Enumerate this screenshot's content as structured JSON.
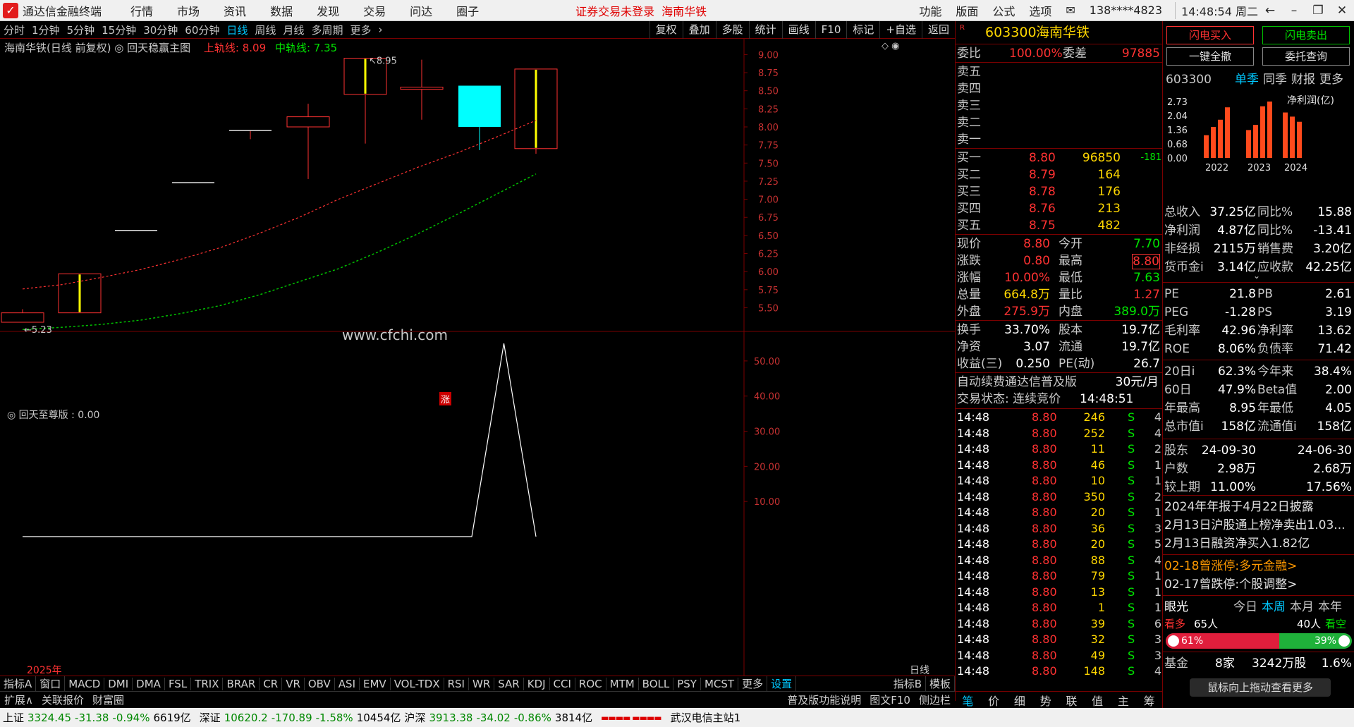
{
  "titlebar": {
    "app": "通达信金融终端",
    "menus": [
      "行情",
      "市场",
      "资讯",
      "数据",
      "发现",
      "交易",
      "问达",
      "圈子"
    ],
    "notice": "证券交易未登录",
    "stock": "海南华铁",
    "right_menus": [
      "功能",
      "版面",
      "公式",
      "选项"
    ],
    "account": "138****4823",
    "clock": "14:48:54 周二"
  },
  "periods": [
    "分时",
    "1分钟",
    "5分钟",
    "15分钟",
    "30分钟",
    "60分钟",
    "日线",
    "周线",
    "月线",
    "多周期",
    "更多"
  ],
  "active_period": "日线",
  "tools": [
    "复权",
    "叠加",
    "多股",
    "统计",
    "画线",
    "F10",
    "标记",
    "+自选",
    "返回"
  ],
  "chart_header": {
    "name": "海南华铁(日线 前复权)",
    "formula": "回天稳赢主图",
    "upper_label": "上轨线: 8.09",
    "mid_label": "中轨线: 7.35"
  },
  "chart_data": [
    {
      "type": "candlestick",
      "ylim": [
        5.3,
        9.15
      ],
      "y_ticks": [
        9.0,
        8.75,
        8.5,
        8.25,
        8.0,
        7.75,
        7.5,
        7.25,
        7.0,
        6.75,
        6.5,
        6.25,
        6.0,
        5.75,
        5.5
      ],
      "candles": [
        {
          "o": 5.3,
          "c": 5.43,
          "h": 5.48,
          "l": 5.3,
          "limit_up": false
        },
        {
          "o": 5.43,
          "c": 5.97,
          "h": 5.97,
          "l": 5.43,
          "limit_up": true
        },
        {
          "o": 6.57,
          "c": 6.57,
          "h": 6.57,
          "l": 6.57,
          "limit_up": false
        },
        {
          "o": 7.23,
          "c": 7.23,
          "h": 7.23,
          "l": 7.23,
          "limit_up": false
        },
        {
          "o": 7.95,
          "c": 7.95,
          "h": 7.95,
          "l": 7.83,
          "limit_up": false
        },
        {
          "o": 8.0,
          "c": 8.14,
          "h": 8.32,
          "l": 7.28,
          "limit_up": false
        },
        {
          "o": 8.45,
          "c": 8.95,
          "h": 8.95,
          "l": 7.77,
          "limit_up": true
        },
        {
          "o": 8.52,
          "c": 8.55,
          "h": 8.93,
          "l": 8.1,
          "limit_up": false
        },
        {
          "o": 8.57,
          "c": 8.0,
          "h": 8.57,
          "l": 7.68,
          "limit_up": false
        },
        {
          "o": 7.7,
          "c": 8.8,
          "h": 8.8,
          "l": 7.63,
          "limit_up": true
        }
      ],
      "upper": [
        5.76,
        5.82,
        5.92,
        6.03,
        6.17,
        6.33,
        6.53,
        6.75,
        7.0,
        7.22,
        7.44,
        7.64,
        7.86,
        8.09
      ],
      "middle": [
        5.2,
        5.23,
        5.27,
        5.33,
        5.42,
        5.53,
        5.68,
        5.86,
        6.04,
        6.27,
        6.52,
        6.79,
        7.07,
        7.35
      ],
      "annotations": {
        "high": "8.95",
        "low": "5.23"
      }
    },
    {
      "type": "line",
      "name": "回天至尊版",
      "value_label": "回天至尊版 : 0.00",
      "ylim": [
        0,
        57
      ],
      "y_ticks": [
        50,
        40,
        30,
        20,
        10
      ],
      "values": [
        0,
        0,
        0,
        0,
        0,
        0,
        0,
        0,
        0,
        0,
        0,
        0,
        0,
        0,
        0,
        55,
        0
      ]
    }
  ],
  "watermark": "www.cfchi.com",
  "limit_mark": "涨",
  "x_label": "2025年",
  "x_period_label": "日线",
  "quote": {
    "code": "603300",
    "name": "海南华铁",
    "badge": "R",
    "wb_label": "委比",
    "wb": "100.00%",
    "wc_label": "委差",
    "wc": "97885",
    "asks": [
      {
        "l": "卖五"
      },
      {
        "l": "卖四"
      },
      {
        "l": "卖三"
      },
      {
        "l": "卖二"
      },
      {
        "l": "卖一"
      }
    ],
    "bids": [
      {
        "l": "买一",
        "p": "8.80",
        "v": "96850",
        "c": "-181"
      },
      {
        "l": "买二",
        "p": "8.79",
        "v": "164",
        "c": ""
      },
      {
        "l": "买三",
        "p": "8.78",
        "v": "176",
        "c": ""
      },
      {
        "l": "买四",
        "p": "8.76",
        "v": "213",
        "c": ""
      },
      {
        "l": "买五",
        "p": "8.75",
        "v": "482",
        "c": ""
      }
    ],
    "stats": [
      [
        "现价",
        "8.80",
        "今开",
        "7.70"
      ],
      [
        "涨跌",
        "0.80",
        "最高",
        "8.80"
      ],
      [
        "涨幅",
        "10.00%",
        "最低",
        "7.63"
      ],
      [
        "总量",
        "664.8万",
        "量比",
        "1.27"
      ],
      [
        "外盘",
        "275.9万",
        "内盘",
        "389.0万"
      ]
    ],
    "stats2": [
      [
        "换手",
        "33.70%",
        "股本",
        "19.7亿"
      ],
      [
        "净资",
        "3.07",
        "流通",
        "19.7亿"
      ],
      [
        "收益(三)",
        "0.250",
        "PE(动)",
        "26.7"
      ]
    ],
    "fee_text": "自动续费通达信普及版",
    "fee_price": "30元/月",
    "trade_state": "交易状态: 连续竞价",
    "trade_time": "14:48:51",
    "ticks": [
      [
        "14:48",
        "8.80",
        "246",
        "S",
        "4"
      ],
      [
        "14:48",
        "8.80",
        "252",
        "S",
        "4"
      ],
      [
        "14:48",
        "8.80",
        "11",
        "S",
        "2"
      ],
      [
        "14:48",
        "8.80",
        "46",
        "S",
        "1"
      ],
      [
        "14:48",
        "8.80",
        "10",
        "S",
        "1"
      ],
      [
        "14:48",
        "8.80",
        "350",
        "S",
        "2"
      ],
      [
        "14:48",
        "8.80",
        "20",
        "S",
        "1"
      ],
      [
        "14:48",
        "8.80",
        "36",
        "S",
        "3"
      ],
      [
        "14:48",
        "8.80",
        "20",
        "S",
        "5"
      ],
      [
        "14:48",
        "8.80",
        "88",
        "S",
        "4"
      ],
      [
        "14:48",
        "8.80",
        "79",
        "S",
        "1"
      ],
      [
        "14:48",
        "8.80",
        "13",
        "S",
        "1"
      ],
      [
        "14:48",
        "8.80",
        "1",
        "S",
        "1"
      ],
      [
        "14:48",
        "8.80",
        "39",
        "S",
        "6"
      ],
      [
        "14:48",
        "8.80",
        "32",
        "S",
        "3"
      ],
      [
        "14:48",
        "8.80",
        "49",
        "S",
        "3"
      ],
      [
        "14:48",
        "8.80",
        "148",
        "S",
        "4"
      ]
    ],
    "tabs": [
      "笔",
      "价",
      "细",
      "势",
      "联",
      "值",
      "主",
      "筹"
    ]
  },
  "fpanel": {
    "buttons": [
      "闪电买入",
      "闪电卖出",
      "一键全撤",
      "委托查询"
    ],
    "code": "603300",
    "tabs": [
      "单季",
      "同季",
      "财报",
      "更多"
    ],
    "chart_title": "净利润(亿)",
    "yticks": [
      "2.73",
      "2.04",
      "1.36",
      "0.68",
      "0.00"
    ],
    "years": [
      "2022",
      "2023",
      "2024"
    ],
    "bars": [
      [
        1.1,
        1.5,
        1.85,
        2.45
      ],
      [
        1.35,
        1.6,
        2.5,
        2.73
      ],
      [
        2.2,
        2.0,
        1.75
      ]
    ],
    "fin": [
      [
        "总收入",
        "37.25亿",
        "同比%",
        "15.88"
      ],
      [
        "净利润",
        "4.87亿",
        "同比%",
        "-13.41"
      ],
      [
        "非经损",
        "2115万",
        "销售费",
        "3.20亿"
      ],
      [
        "货币金i",
        "3.14亿",
        "应收款",
        "42.25亿"
      ]
    ],
    "val": [
      [
        "PE",
        "21.8",
        "PB",
        "2.61"
      ],
      [
        "PEG",
        "-1.28",
        "PS",
        "3.19"
      ],
      [
        "毛利率",
        "42.96",
        "净利率",
        "13.62"
      ],
      [
        "ROE",
        "8.06%",
        "负债率",
        "71.42"
      ]
    ],
    "perf": [
      [
        "20日i",
        "62.3%",
        "今年来",
        "38.4%"
      ],
      [
        "60日",
        "47.9%",
        "Beta值",
        "2.00"
      ],
      [
        "年最高",
        "8.95",
        "年最低",
        "4.05"
      ],
      [
        "总市值i",
        "158亿",
        "流通值i",
        "158亿"
      ]
    ],
    "hold": {
      "h1": "股东",
      "d1": "24-09-30",
      "d2": "24-06-30",
      "r1": [
        "户数",
        "2.98万",
        "2.68万"
      ],
      "r2": [
        "较上期",
        "11.00%",
        "17.56%"
      ]
    },
    "news": [
      "2024年年报于4月22日披露",
      "2月13日沪股通上榜净卖出1.03...",
      "2月13日融资净买入1.82亿"
    ],
    "events": [
      "02-18曾涨停:多元金融>",
      "02-17曾跌停:个股调整>"
    ],
    "eye": {
      "label": "眼光",
      "tabs": [
        "今日",
        "本周",
        "本月",
        "本年"
      ],
      "bull": "看多",
      "bull_n": "65人",
      "bear_n": "40人",
      "bear": "看空",
      "bull_pct": "61%",
      "bear_pct": "39%",
      "bull_ratio": 0.61
    },
    "fund": [
      "基金",
      "8家",
      "3242万股",
      "1.6%"
    ],
    "hint": "鼠标向上拖动查看更多"
  },
  "indicators": [
    "指标A",
    "窗口",
    "MACD",
    "DMI",
    "DMA",
    "FSL",
    "TRIX",
    "BRAR",
    "CR",
    "VR",
    "OBV",
    "ASI",
    "EMV",
    "VOL-TDX",
    "RSI",
    "WR",
    "SAR",
    "KDJ",
    "CCI",
    "ROC",
    "MTM",
    "BOLL",
    "PSY",
    "MCST",
    "更多",
    "设置"
  ],
  "ind_right": [
    "指标B",
    "模板"
  ],
  "ext": [
    "扩展∧",
    "关联报价",
    "财富圈"
  ],
  "ext_right": [
    "普及版功能说明",
    "图文F10",
    "侧边栏"
  ],
  "statusbar": {
    "sh_label": "上证",
    "sh": "3324.45",
    "sh_chg": "-31.38",
    "sh_pct": "-0.94%",
    "sh_amt": "6619亿",
    "sz_label": "深证",
    "sz": "10620.2",
    "sz_chg": "-170.89",
    "sz_pct": "-1.58%",
    "sz_amt": "10454亿",
    "hs_label": "沪深",
    "hs": "3913.38",
    "hs_chg": "-34.02",
    "hs_pct": "-0.86%",
    "hs_amt": "3814亿",
    "server": "武汉电信主站1"
  },
  "colors": {
    "up": "#ff3232",
    "down": "#00ffff",
    "upper": "#ff3232",
    "middle": "#00c000",
    "grid": "#7a0000"
  }
}
